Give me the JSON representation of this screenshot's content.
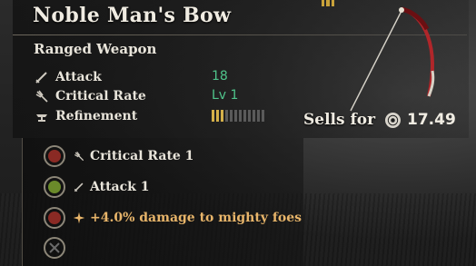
{
  "item": {
    "name": "Noble Man's Bow",
    "category": "Ranged Weapon"
  },
  "stats": [
    {
      "label": "Attack",
      "value": "18",
      "icon": "sword-icon"
    },
    {
      "label": "Critical Rate",
      "value": "Lv 1",
      "icon": "critical-rate-icon"
    },
    {
      "label": "Refinement",
      "icon": "anvil-icon",
      "refinement_level": 3,
      "refinement_max": 12
    }
  ],
  "sell": {
    "label": "Sells for",
    "coin_icon": "coin-icon",
    "price": "17.49"
  },
  "perks": [
    {
      "text": "Critical Rate 1",
      "gem_color": "#8a2a24",
      "icon": "critical-rate-icon",
      "highlight": false
    },
    {
      "text": "Attack 1",
      "gem_color": "#6a8a2a",
      "icon": "sword-icon",
      "highlight": false
    },
    {
      "text": "+4.0% damage to mighty foes",
      "gem_color": "#8a2a24",
      "icon": "burst-icon",
      "highlight": true
    },
    {
      "text": "",
      "gem_color": "#3a3a3a",
      "icon": "empty-slot-icon",
      "highlight": false
    }
  ],
  "colors": {
    "stat_value": "#4fc48b",
    "refine_on": "#d4b049",
    "refine_off": "#5a5a5a",
    "perk_highlight": "#e8b56a"
  }
}
